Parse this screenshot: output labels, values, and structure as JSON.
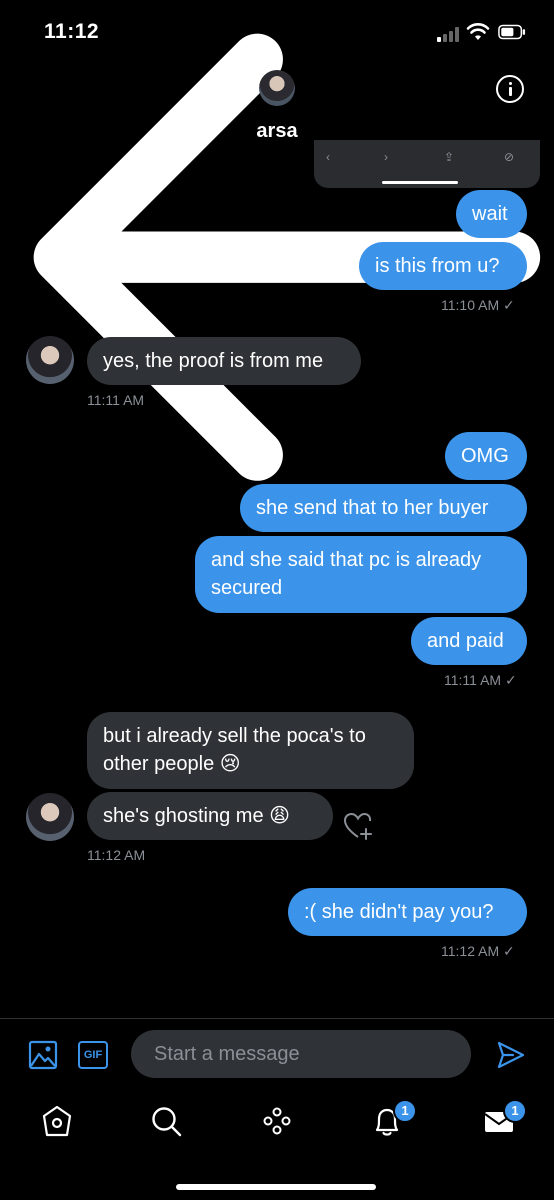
{
  "status_bar": {
    "time": "11:12"
  },
  "header": {
    "name": "arsa"
  },
  "messages": [
    {
      "text": "wait"
    },
    {
      "text": "is this from u?"
    },
    {
      "text": "yes, the proof is from me"
    },
    {
      "text": "OMG"
    },
    {
      "text": "she send that to her buyer"
    },
    {
      "text": "and she said that pc is already secured"
    },
    {
      "text": "and paid"
    },
    {
      "text": "but i already sell the poca's to other people 😢"
    },
    {
      "text": "she's ghosting me 😩"
    },
    {
      "text": ":( she didn't pay you?"
    }
  ],
  "timestamps": {
    "t1": "11:10 AM ✓",
    "t2": "11:11 AM",
    "t3": "11:11 AM ✓",
    "t4": "11:12 AM",
    "t5": "11:12 AM ✓"
  },
  "composer": {
    "placeholder": "Start a message",
    "gif_label": "GIF"
  },
  "tabs": {
    "notifications_badge": "1",
    "messages_badge": "1"
  },
  "colors": {
    "accent": "#3b94e9",
    "incoming": "#2f3236",
    "background": "#000000"
  },
  "icons": [
    "back-arrow-icon",
    "info-icon",
    "image-icon",
    "gif-icon",
    "send-icon",
    "home-icon",
    "search-icon",
    "spaces-icon",
    "bell-icon",
    "mail-icon",
    "heart-plus-icon"
  ]
}
